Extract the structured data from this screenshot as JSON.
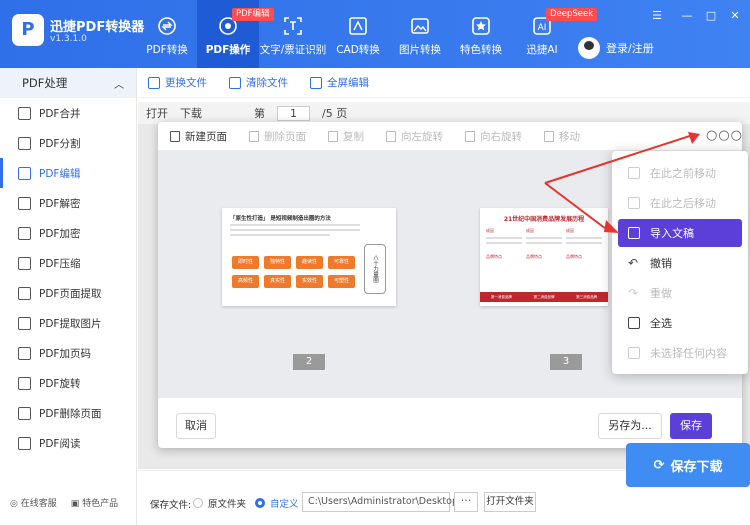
{
  "app": {
    "name": "迅捷PDF转换器",
    "version": "v1.3.1.0"
  },
  "nav": [
    {
      "label": "PDF转换",
      "icon": "convert-icon"
    },
    {
      "label": "PDF操作",
      "icon": "pdf-operate-icon",
      "badge": "PDF编辑"
    },
    {
      "label": "文字/票证识别",
      "icon": "ocr-icon"
    },
    {
      "label": "CAD转换",
      "icon": "cad-icon"
    },
    {
      "label": "图片转换",
      "icon": "image-icon"
    },
    {
      "label": "特色转换",
      "icon": "star-icon"
    },
    {
      "label": "迅捷AI",
      "icon": "ai-icon",
      "badge": "DeepSeek"
    }
  ],
  "user": {
    "login": "登录/注册"
  },
  "sidebar": {
    "header": "PDF处理",
    "items": [
      {
        "label": "PDF合并"
      },
      {
        "label": "PDF分割"
      },
      {
        "label": "PDF编辑"
      },
      {
        "label": "PDF解密"
      },
      {
        "label": "PDF加密"
      },
      {
        "label": "PDF压缩"
      },
      {
        "label": "PDF页面提取"
      },
      {
        "label": "PDF提取图片"
      },
      {
        "label": "PDF加页码"
      },
      {
        "label": "PDF旋转"
      },
      {
        "label": "PDF删除页面"
      },
      {
        "label": "PDF阅读"
      }
    ],
    "footer": {
      "service": "在线客服",
      "products": "特色产品"
    }
  },
  "toolbar": {
    "replace": "更换文件",
    "clear": "清除文件",
    "fullscreen": "全屏编辑"
  },
  "bg": {
    "open": "打开",
    "download": "下载",
    "page_prefix": "第",
    "page": "1",
    "total": "/5 页"
  },
  "modal": {
    "tools": [
      "新建页面",
      "删除页面",
      "复制",
      "向左旋转",
      "向右旋转",
      "移动"
    ],
    "pages": [
      "2",
      "3"
    ],
    "thumb2": {
      "title": "「原生性打造」 是短视频制造出圈的方法",
      "tags": [
        "即时性",
        "独特性",
        "趣读性",
        "可靠性",
        "高频性",
        "真实性",
        "实效性",
        "可塑性"
      ],
      "side": "八十力量圈"
    },
    "thumb3": {
      "title": "21世纪中国消费品牌发展历程",
      "cols": [
        "成因",
        "成因",
        "成因"
      ],
      "subs": [
        "品牌特点",
        "品牌特点",
        "品牌特点"
      ],
      "foot": [
        "第一消费品牌",
        "第二消费品牌",
        "第三消费品牌"
      ]
    },
    "cancel": "取消",
    "saveas": "另存为...",
    "save": "保存"
  },
  "menu": [
    {
      "label": "在此之前移动",
      "enabled": false
    },
    {
      "label": "在此之后移动",
      "enabled": false
    },
    {
      "label": "导入文稿",
      "enabled": true,
      "highlighted": true
    },
    {
      "label": "撤销",
      "enabled": true
    },
    {
      "label": "重做",
      "enabled": false
    },
    {
      "label": "全选",
      "enabled": true
    },
    {
      "label": "未选择任何内容",
      "enabled": false
    }
  ],
  "bottom": {
    "save_label": "保存文件:",
    "opt_original": "原文件夹",
    "opt_custom": "自定义",
    "path": "C:\\Users\\Administrator\\Desktop",
    "dots": "···",
    "open_folder": "打开文件夹",
    "download": "保存下载"
  },
  "colors": {
    "brand": "#2f6fe8",
    "primary_btn": "#5b3fd8",
    "arrow": "#e8322d",
    "badge": "#ff4d4f"
  }
}
